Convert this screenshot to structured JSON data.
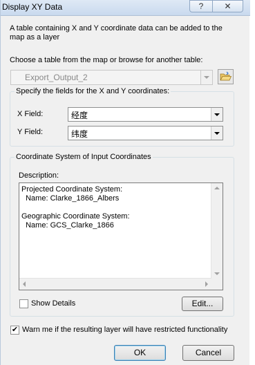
{
  "window": {
    "title": "Display XY Data",
    "help_glyph": "?",
    "close_glyph": "✕"
  },
  "description": "A table containing X and Y coordinate data can be added to the map as a layer",
  "table": {
    "label": "Choose a table from the map or browse for another table:",
    "value": "Export_Output_2"
  },
  "fields": {
    "legend": "Specify the fields for the X and Y coordinates:",
    "x_label": "X Field:",
    "x_value": "经度",
    "y_label": "Y Field:",
    "y_value": "纬度"
  },
  "coord": {
    "legend": "Coordinate System of Input Coordinates",
    "description_label": "Description:",
    "description_text": "Projected Coordinate System:\n  Name: Clarke_1866_Albers\n\nGeographic Coordinate System:\n  Name: GCS_Clarke_1866",
    "show_details_label": "Show Details",
    "show_details_checked": false,
    "edit_label": "Edit..."
  },
  "warn": {
    "label": "Warn me if the resulting layer will have restricted functionality",
    "checked": true,
    "check_glyph": "✔"
  },
  "buttons": {
    "ok": "OK",
    "cancel": "Cancel"
  }
}
